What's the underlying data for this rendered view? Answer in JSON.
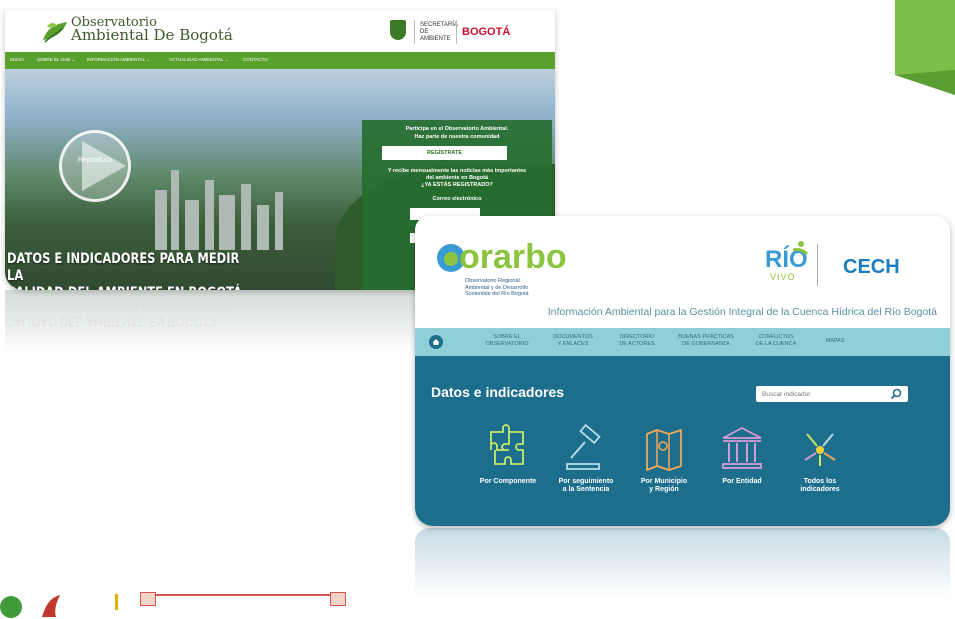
{
  "colors": {
    "accent_green": "#5aa02c",
    "corner_green": "#7cc04a",
    "orarbo_blue": "#1d6e8d",
    "orarbo_nav": "#8fd0d8"
  },
  "oab": {
    "logo_line1": "Observatorio",
    "logo_line2": "Ambiental De Bogotá",
    "partners": {
      "ambiente": "SECRETARÍA DE AMBIENTE",
      "bogota": "BOGOTÁ"
    },
    "nav": [
      "INICIO",
      "SOBRE EL OAB ⌄",
      "INFORMACIÓN AMBIENTAL ⌄",
      "ACTUALIDAD AMBIENTAL ⌄",
      "CONTACTO"
    ],
    "play_label": "Reproducir",
    "panel": {
      "line1": "Participa en el Observatorio Ambiental.",
      "line2": "Haz parte de nuestra comunidad",
      "register": "REGÍSTRATE",
      "line3": "Y recibe mensualmente las noticias más importantes",
      "line4": "del ambiente en Bogotá",
      "line5": "¿YA ESTÁS REGISTRADO?",
      "email_label": "Correo electrónico"
    },
    "headline_line1": "DATOS E INDICADORES PARA MEDIR LA",
    "headline_line2": "CALIDAD DEL AMBIENTE EN BOGOTÁ"
  },
  "orarbo": {
    "logo": "orarbo",
    "logo_sub1": "Observatorio Regional",
    "logo_sub2": "Ambiental y de Desarrollo",
    "logo_sub3": "Sostenible del Río Bogotá",
    "rio": "RÍO",
    "vivo": "VIVO",
    "cech": "CECH",
    "tagline": "Información Ambiental para la Gestión Integral de la Cuenca Hídrica del Río Bogotá",
    "nav": [
      {
        "l1": "SOBRE EL",
        "l2": "OBSERVATORIO"
      },
      {
        "l1": "DOCUMENTOS",
        "l2": "Y ENLACES"
      },
      {
        "l1": "DIRECTORIO",
        "l2": "DE ACTORES"
      },
      {
        "l1": "BUENAS PRÁCTICAS",
        "l2": "DE GOBERNANZA"
      },
      {
        "l1": "CONFLICTOS",
        "l2": "DE LA CUENCA"
      },
      {
        "l1": "MAPAS",
        "l2": ""
      }
    ],
    "section_title": "Datos e indicadores",
    "search_placeholder": "Buscar indicador",
    "categories": [
      {
        "l1": "Por Componente",
        "l2": ""
      },
      {
        "l1": "Por seguimiento",
        "l2": "a la Sentencia"
      },
      {
        "l1": "Por Municipio",
        "l2": "y Región"
      },
      {
        "l1": "Por Entidad",
        "l2": ""
      },
      {
        "l1": "Todos los",
        "l2": "indicadores"
      }
    ]
  }
}
